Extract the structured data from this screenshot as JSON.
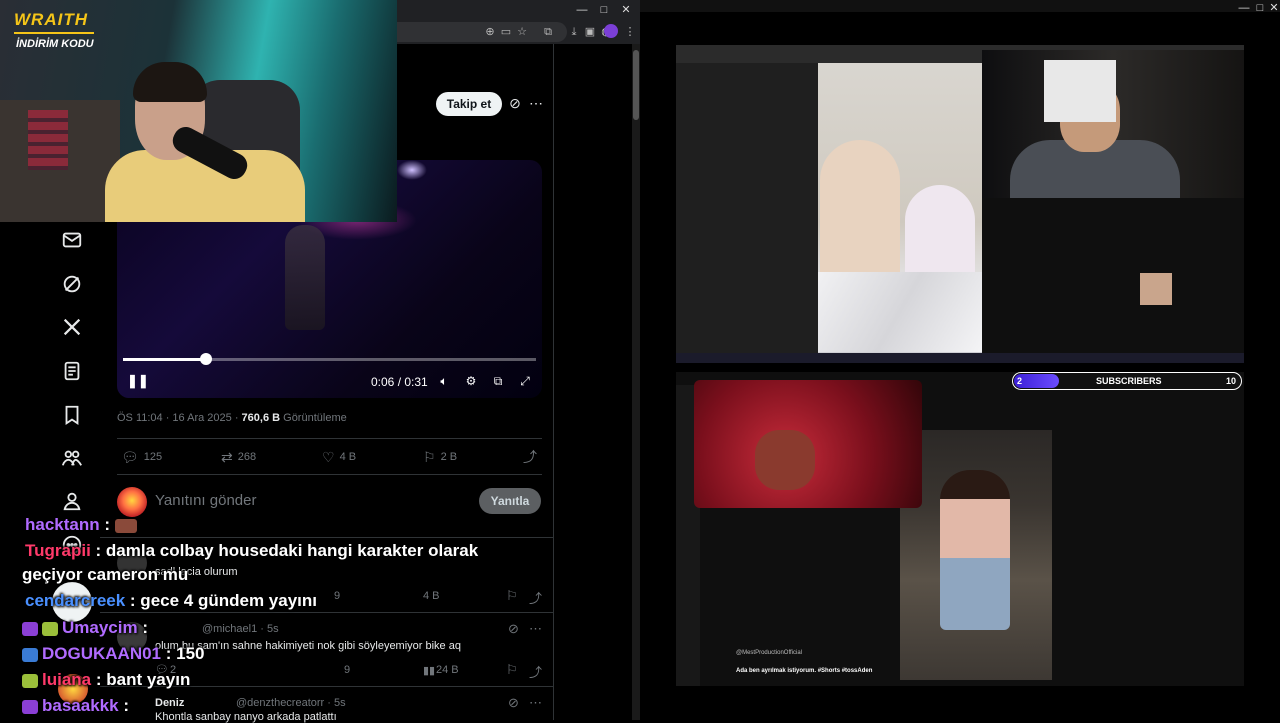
{
  "overlay": {
    "brand": "WRAITH",
    "promo": "İNDİRİM KODU"
  },
  "x_post": {
    "follow_label": "Takip et",
    "video": {
      "time": "0:06 / 0:31",
      "progress": 0.2
    },
    "meta": {
      "datetime": "ÖS 11:04 · 16 Ara 2025 · ",
      "views": "760,6 B",
      "views_label": " Görüntüleme"
    },
    "stats": {
      "replies": "125",
      "reposts": "268",
      "likes": "4 B",
      "bookmarks": "2 B"
    },
    "reply_placeholder": "Yanıtını gönder",
    "reply_button": "Yanıtla",
    "replies": [
      {
        "handle": "",
        "text": "sadl lacia olurum",
        "stats": [
          "",
          "",
          "9",
          "4 B"
        ]
      },
      {
        "handle": "@michael1 · 5s",
        "text": "olum bu şam'ın sahne hakimiyeti nok gibi söyleyemiyor bike aq",
        "stats": [
          "2",
          "",
          "9",
          "24 B"
        ]
      },
      {
        "name": "Deniz",
        "handle": "@denzthecreatorr · 5s",
        "text": "Khontla sanbay nanyo arkada patlattı"
      }
    ]
  },
  "chat": [
    {
      "user": "hacktann",
      "text": ":",
      "color": "#b06bff"
    },
    {
      "user": "Tugrapii",
      "text": ": damla colbay housedaki hangi karakter olarak",
      "color": "#ff3a6a"
    },
    {
      "user": "",
      "text": "geçiyor cameron mu",
      "color": "#ffffff"
    },
    {
      "user": "cendarcreek",
      "text": ": gece 4 gündem yayını",
      "color": "#4a90ff"
    },
    {
      "user": "Umaycim",
      "text": ":",
      "color": "#b06bff"
    },
    {
      "user": "DOGUKAAN01",
      "text": ": 150",
      "color": "#b06bff"
    },
    {
      "user": "luiana",
      "text": ": bant yayın",
      "color": "#ff3a6a"
    },
    {
      "user": "basaakkk",
      "text": ":",
      "color": "#b06bff"
    }
  ],
  "right": {
    "subscribers_label": "SUBSCRIBERS",
    "subscribers_current": "2",
    "subscribers_goal": "10",
    "subscriber_progress": 0.2,
    "q2_caption": "Ada ben ayrılmak istiyorum. #Shorts #tossAden",
    "q2_channel": "@MestProductionOfficial"
  },
  "icons": {
    "nav": [
      "mail-icon",
      "grok-icon",
      "x-logo-icon",
      "lists-icon",
      "bookmark-icon",
      "communities-icon",
      "profile-icon",
      "more-icon"
    ]
  },
  "colors": {
    "x_bg": "#000000",
    "follow_bg": "#eff3f4",
    "reply_btn_bg": "#5c5f62",
    "brand_yellow": "#f5c518"
  }
}
